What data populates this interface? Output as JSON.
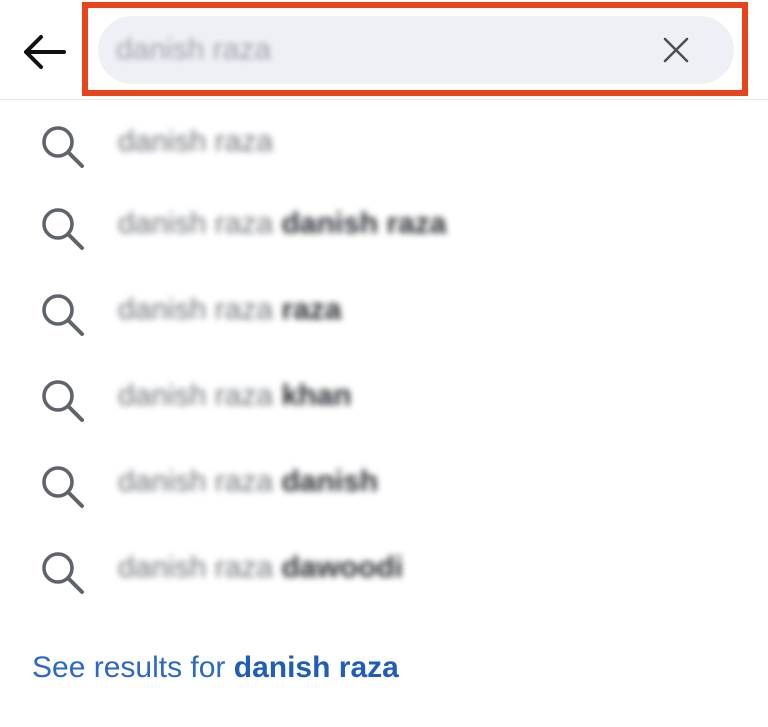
{
  "header": {
    "back_icon": "arrow-left-icon",
    "search_value": "danish raza",
    "clear_icon": "close-icon",
    "highlight_color": "#e8431b"
  },
  "suggestions": [
    {
      "base": "danish raza",
      "bold": ""
    },
    {
      "base": "danish raza ",
      "bold": "danish raza"
    },
    {
      "base": "danish raza ",
      "bold": "raza"
    },
    {
      "base": "danish raza ",
      "bold": "khan"
    },
    {
      "base": "danish raza ",
      "bold": "danish"
    },
    {
      "base": "danish raza ",
      "bold": "dawoodi"
    }
  ],
  "suggestion_icon": "search-icon",
  "see_results": {
    "prefix": "See results for ",
    "query": "danish raza",
    "link_color": "#2b68c8"
  }
}
